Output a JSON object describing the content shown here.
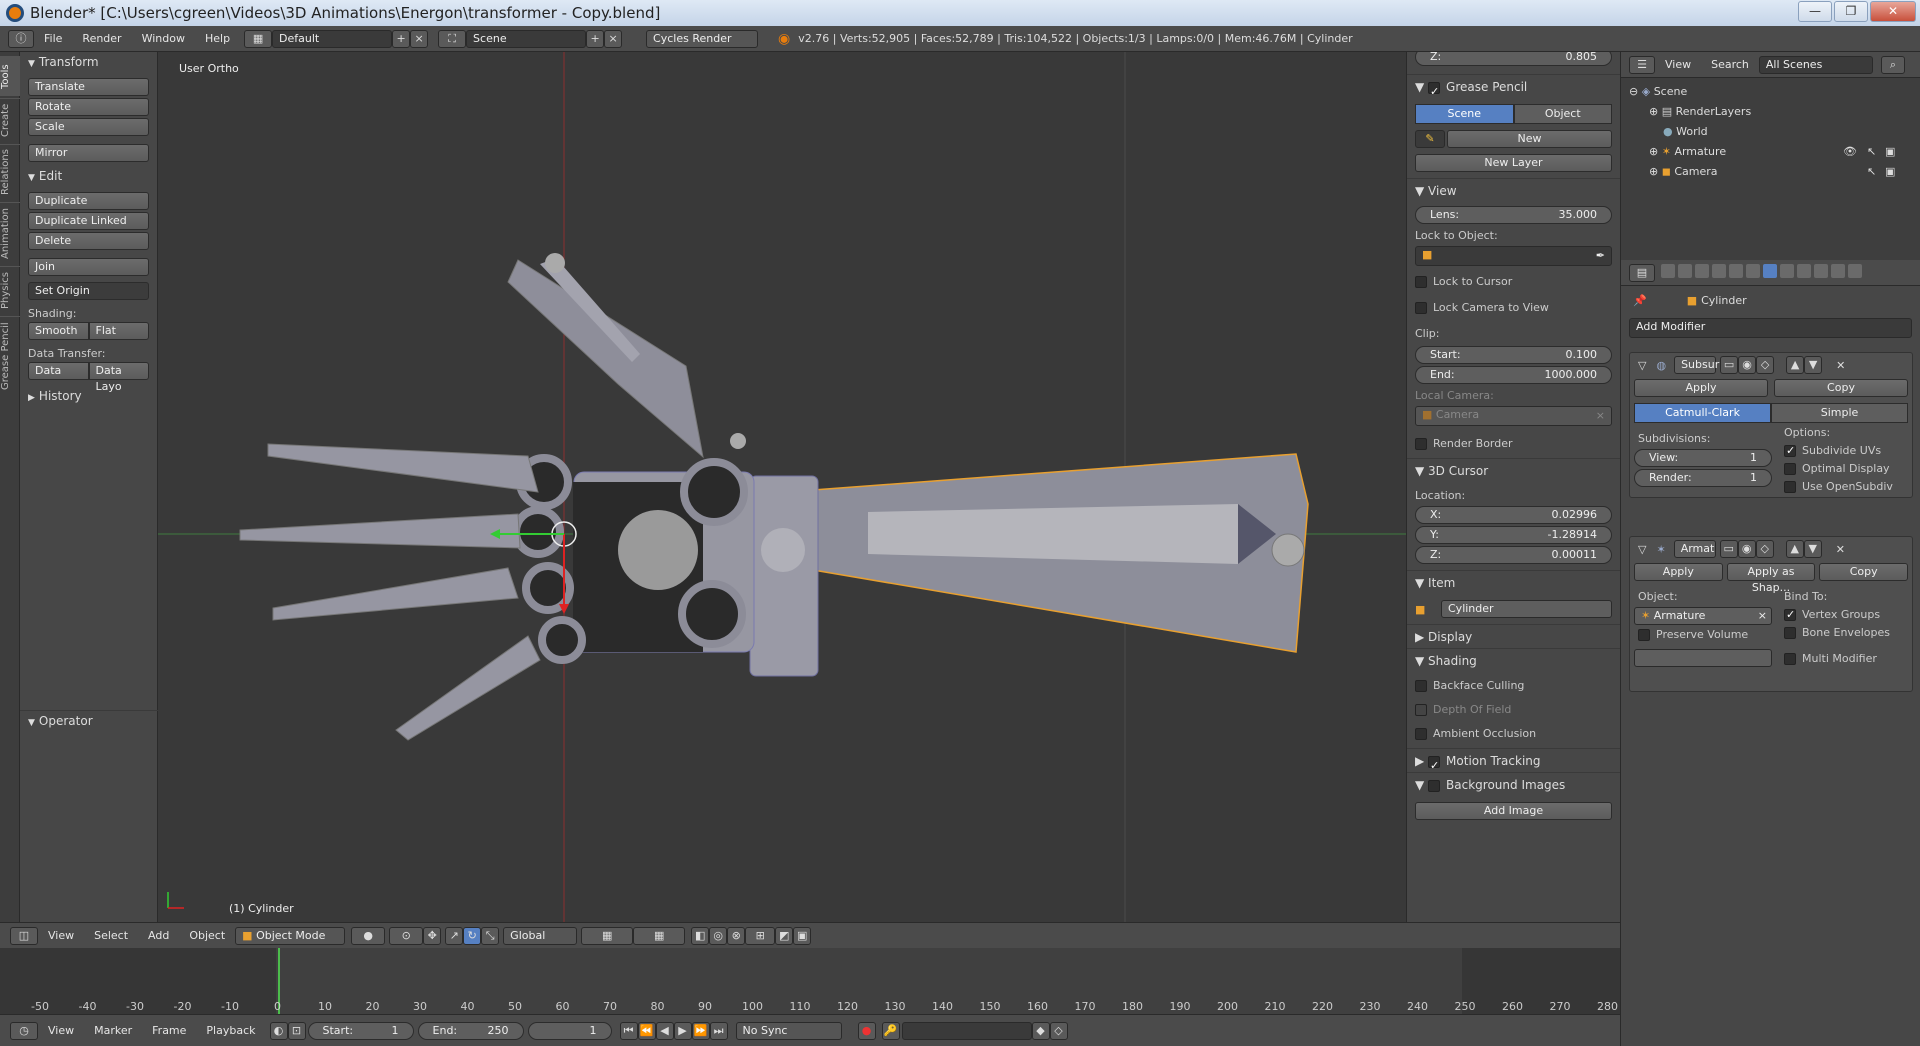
{
  "window": {
    "title": "Blender* [C:\\Users\\cgreen\\Videos\\3D Animations\\Energon\\transformer - Copy.blend]",
    "minimize": "—",
    "restore": "❐",
    "close": "✕"
  },
  "infobar": {
    "menus": [
      "File",
      "Render",
      "Window",
      "Help"
    ],
    "layout": "Default",
    "scene": "Scene",
    "engine": "Cycles Render",
    "stats": "v2.76 | Verts:52,905 | Faces:52,789 | Tris:104,522 | Objects:1/3 | Lamps:0/0 | Mem:46.76M | Cylinder"
  },
  "tool_tabs": [
    "Tools",
    "Create",
    "Relations",
    "Animation",
    "Physics",
    "Grease Pencil"
  ],
  "toolshelf": {
    "transform_header": "Transform",
    "translate": "Translate",
    "rotate": "Rotate",
    "scale": "Scale",
    "mirror": "Mirror",
    "edit_header": "Edit",
    "duplicate": "Duplicate",
    "duplicate_linked": "Duplicate Linked",
    "delete": "Delete",
    "join": "Join",
    "set_origin": "Set Origin",
    "shading_label": "Shading:",
    "smooth": "Smooth",
    "flat": "Flat",
    "data_transfer_label": "Data Transfer:",
    "data": "Data",
    "data_layo": "Data Layo",
    "history_header": "History",
    "operator_header": "Operator"
  },
  "viewport": {
    "view_label": "User Ortho",
    "object_label": "(1) Cylinder"
  },
  "npanel": {
    "z_top": "Z:",
    "z_top_value": "0.805",
    "grease_pencil": "Grease Pencil",
    "scene_tab": "Scene",
    "object_tab": "Object",
    "new": "New",
    "new_layer": "New Layer",
    "view_header": "View",
    "lens_label": "Lens:",
    "lens_value": "35.000",
    "lock_to_object": "Lock to Object:",
    "lock_to_cursor": "Lock to Cursor",
    "lock_camera": "Lock Camera to View",
    "clip_label": "Clip:",
    "start_label": "Start:",
    "start_value": "0.100",
    "end_label": "End:",
    "end_value": "1000.000",
    "local_camera": "Local Camera:",
    "camera_field": "Camera",
    "render_border": "Render Border",
    "cursor_header": "3D Cursor",
    "location_label": "Location:",
    "x_label": "X:",
    "x_value": "0.02996",
    "y_label": "Y:",
    "y_value": "-1.28914",
    "z_label": "Z:",
    "z_value": "0.00011",
    "item_header": "Item",
    "item_name": "Cylinder",
    "display_header": "Display",
    "shading_header": "Shading",
    "backface": "Backface Culling",
    "dof": "Depth Of Field",
    "ao": "Ambient Occlusion",
    "motion_tracking": "Motion Tracking",
    "bg_images": "Background Images",
    "add_image": "Add Image"
  },
  "outliner": {
    "view": "View",
    "search": "Search",
    "scenes": "All Scenes",
    "scene": "Scene",
    "render_layers": "RenderLayers",
    "world": "World",
    "armature": "Armature",
    "camera": "Camera"
  },
  "properties": {
    "breadcrumb": "Cylinder",
    "add_modifier": "Add Modifier",
    "subsurf": {
      "name": "Subsur",
      "apply": "Apply",
      "copy": "Copy",
      "catmull": "Catmull-Clark",
      "simple": "Simple",
      "subdivisions": "Subdivisions:",
      "options": "Options:",
      "view_label": "View:",
      "view_value": "1",
      "render_label": "Render:",
      "render_value": "1",
      "subdivide_uvs": "Subdivide UVs",
      "optimal_display": "Optimal Display",
      "use_opensubdiv": "Use OpenSubdiv"
    },
    "armature_mod": {
      "name": "Armat",
      "apply": "Apply",
      "apply_shape": "Apply as Shap...",
      "copy": "Copy",
      "object_label": "Object:",
      "object_value": "Armature",
      "bind_to": "Bind To:",
      "preserve_volume": "Preserve Volume",
      "vertex_groups": "Vertex Groups",
      "bone_envelopes": "Bone Envelopes",
      "multi_modifier": "Multi Modifier"
    }
  },
  "viewport_header": {
    "view": "View",
    "select": "Select",
    "add": "Add",
    "object": "Object",
    "mode": "Object Mode",
    "orientation": "Global"
  },
  "timeline": {
    "ticks": [
      "-50",
      "-40",
      "-30",
      "-20",
      "-10",
      "0",
      "10",
      "20",
      "30",
      "40",
      "50",
      "60",
      "70",
      "80",
      "90",
      "100",
      "110",
      "120",
      "130",
      "140",
      "150",
      "160",
      "170",
      "180",
      "190",
      "200",
      "210",
      "220",
      "230",
      "240",
      "250",
      "260",
      "270",
      "280"
    ],
    "view": "View",
    "marker": "Marker",
    "frame": "Frame",
    "playback": "Playback",
    "start_label": "Start:",
    "start_value": "1",
    "end_label": "End:",
    "end_value": "250",
    "current": "1",
    "sync": "No Sync"
  }
}
